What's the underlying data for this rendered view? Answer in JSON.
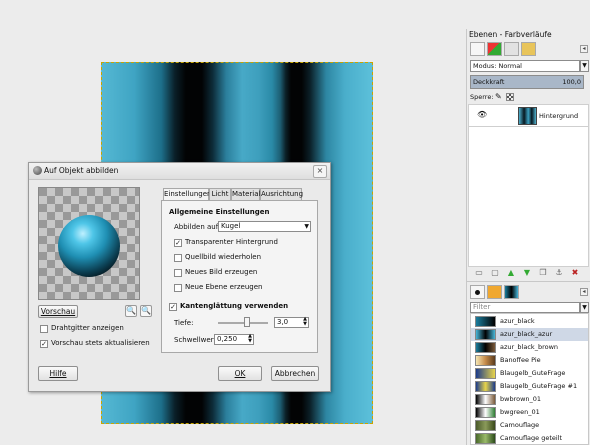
{
  "colors": {
    "selection_accent": "#c9a400",
    "azur": "#4fc6e8"
  },
  "dialog": {
    "title": "Auf Objekt abbilden",
    "close_glyph": "×",
    "preview_button": "Vorschau",
    "options": {
      "grid": "Drahtgitter anzeigen",
      "auto_preview": "Vorschau stets aktualisieren"
    },
    "help_button": "Hilfe",
    "ok_button": "OK",
    "cancel_button": "Abbrechen",
    "tabs": [
      "Einstellungen",
      "Licht",
      "Material",
      "Ausrichtung"
    ],
    "section_title": "Allgemeine Einstellungen",
    "map_label": "Abbilden auf:",
    "map_value": "Kugel",
    "checks": {
      "transparent": "Transparenter Hintergrund",
      "tile": "Quellbild wiederholen",
      "new_image": "Neues Bild erzeugen",
      "new_layer": "Neue Ebene erzeugen"
    },
    "antialias_label": "Kantenglättung verwenden",
    "depth_label": "Tiefe:",
    "depth_value": "3,0",
    "depth_fraction": 0.58,
    "threshold_label": "Schwellwert:",
    "threshold_value": "0,250"
  },
  "layers_panel": {
    "title": "Ebenen - Farbverläufe",
    "mode_label": "Modus: Normal",
    "opacity_label": "Deckkraft",
    "opacity_value": "100,0",
    "opacity_fraction": 1.0,
    "lock_label": "Sperre:",
    "layer_name": "Hintergrund",
    "filter_placeholder": "Filter",
    "gradients": [
      {
        "name": "azur_black",
        "colors": [
          "#1a7e9e",
          "#000000"
        ]
      },
      {
        "name": "azur_black_azur",
        "colors": [
          "#46b5d8",
          "#000000",
          "#46b5d8"
        ]
      },
      {
        "name": "azur_black_brown",
        "colors": [
          "#1a7e9e",
          "#000000",
          "#7a5a3a"
        ]
      },
      {
        "name": "Banoffee Pie",
        "colors": [
          "#f6e7b4",
          "#c58b4a",
          "#5a3b1d"
        ]
      },
      {
        "name": "Blaugelb_GuteFrage",
        "colors": [
          "#1b3b8b",
          "#e8d44a"
        ]
      },
      {
        "name": "Blaugelb_GuteFrage #1",
        "colors": [
          "#1b3b8b",
          "#e8d44a",
          "#1b3b8b"
        ]
      },
      {
        "name": "bwbrown_01",
        "colors": [
          "#000000",
          "#ffffff",
          "#7a5a3a"
        ]
      },
      {
        "name": "bwgreen_01",
        "colors": [
          "#000000",
          "#ffffff",
          "#2e7d32"
        ]
      },
      {
        "name": "Camouflage",
        "colors": [
          "#4a5a2a",
          "#8a9a5a",
          "#3a4a1a"
        ]
      },
      {
        "name": "Camouflage geteilt",
        "colors": [
          "#4a6a2a",
          "#9aba6a",
          "#2a4a1a"
        ]
      }
    ]
  }
}
